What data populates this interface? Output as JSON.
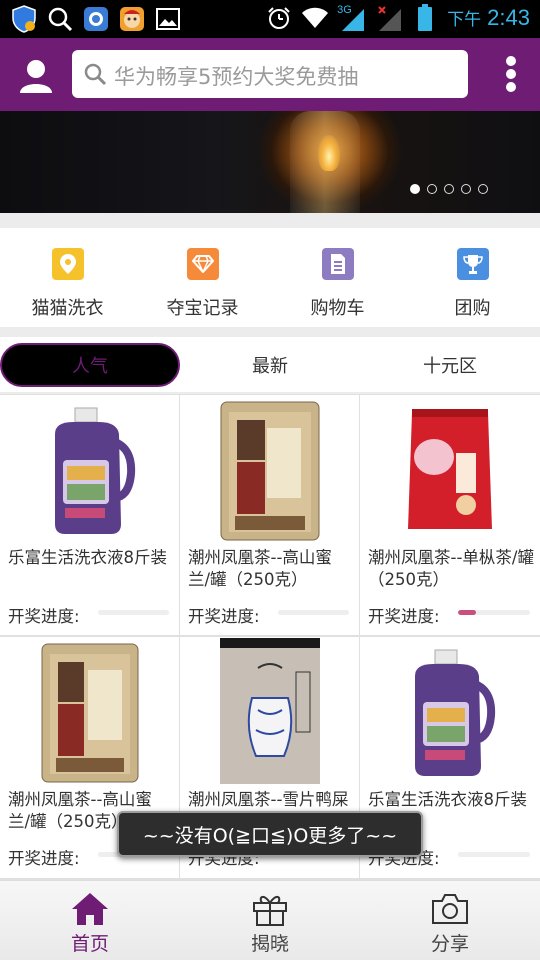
{
  "status_bar": {
    "time": "2:43",
    "ampm": "下午",
    "network_label": "3G",
    "left_icons": [
      "shield-icon",
      "search-icon",
      "app-icon",
      "game-icon",
      "gallery-icon"
    ],
    "right_icons": [
      "alarm-icon",
      "wifi-icon",
      "signal-3g-icon",
      "signal-no-sim-icon",
      "battery-icon"
    ]
  },
  "header": {
    "search_placeholder": "华为畅享5预约大奖免费抽",
    "user_icon": "user-icon",
    "more_icon": "more-vertical-icon"
  },
  "banner": {
    "slide_count": 5,
    "active_slide": 0
  },
  "quick_menu": [
    {
      "label": "猫猫洗衣",
      "icon": "location-pin-icon",
      "color": "#f5c22b"
    },
    {
      "label": "夺宝记录",
      "icon": "diamond-icon",
      "color": "#f58a3a"
    },
    {
      "label": "购物车",
      "icon": "document-icon",
      "color": "#8e7cc3"
    },
    {
      "label": "团购",
      "icon": "trophy-icon",
      "color": "#4a8fe0"
    }
  ],
  "tabs": [
    {
      "label": "人气",
      "active": true
    },
    {
      "label": "最新",
      "active": false
    },
    {
      "label": "十元区",
      "active": false
    }
  ],
  "progress_label": "开奖进度:",
  "products": [
    {
      "name": "乐富生活洗衣液8斤装",
      "image": "detergent-bottle",
      "progress": 0.0
    },
    {
      "name": "潮州凤凰茶--高山蜜兰/罐（250克）",
      "image": "tea-tin-gold",
      "progress": 0.0
    },
    {
      "name": "潮州凤凰茶--单枞茶/罐（250克）",
      "image": "tea-bag-red",
      "progress": 0.25
    },
    {
      "name": "潮州凤凰茶--高山蜜兰/罐（250克）",
      "image": "tea-tin-gold",
      "progress": 0.0
    },
    {
      "name": "潮州凤凰茶--雪片鸭屎香/罐（250克）",
      "image": "tea-tin-vase",
      "progress": 0.35
    },
    {
      "name": "乐富生活洗衣液8斤装",
      "image": "detergent-bottle",
      "progress": 0.0
    }
  ],
  "toast": {
    "message": "~~没有O(≧口≦)O更多了~~"
  },
  "bottom_nav": [
    {
      "label": "首页",
      "icon": "home-icon",
      "active": true
    },
    {
      "label": "揭晓",
      "icon": "gift-icon",
      "active": false
    },
    {
      "label": "分享",
      "icon": "camera-icon",
      "active": false
    }
  ],
  "colors": {
    "brand_purple": "#6e1c74",
    "progress_pink": "#c8507e",
    "time_blue": "#38b6e8"
  }
}
